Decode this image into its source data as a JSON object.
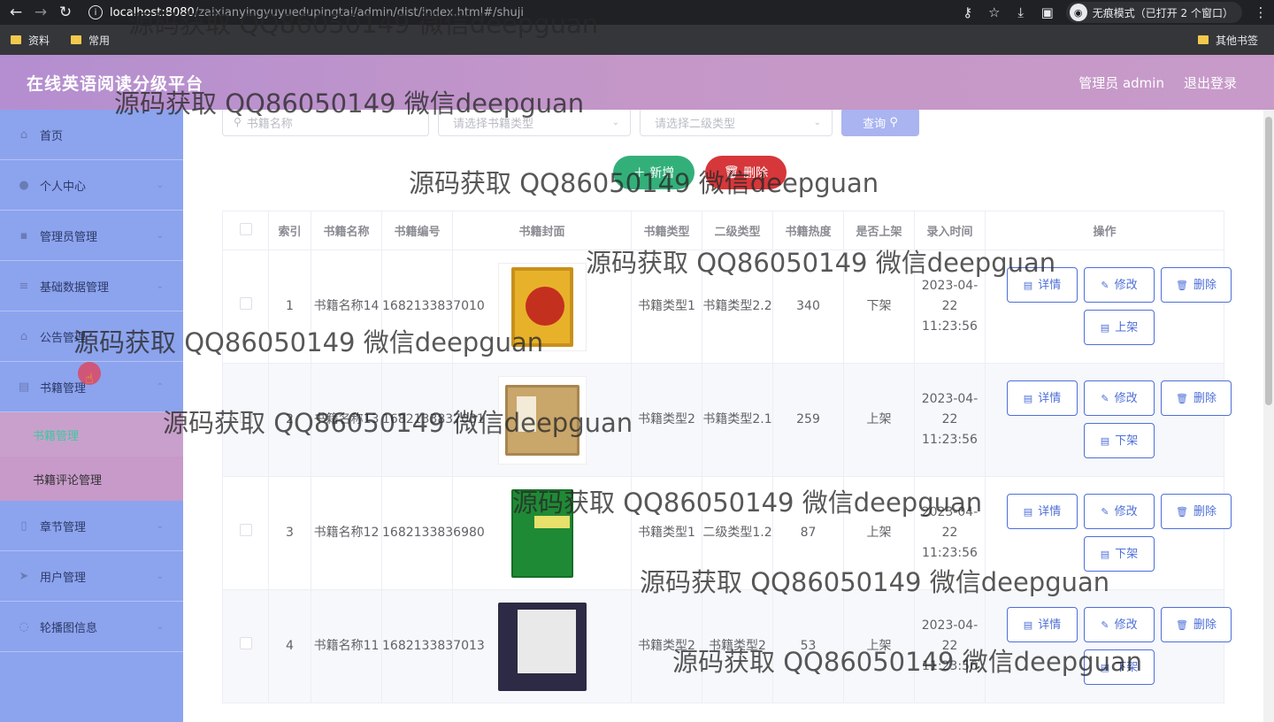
{
  "browser": {
    "url_host": "localhost:8080",
    "url_path": "/zaixianyingyuyuedupingtai/admin/dist/index.html#/shuji",
    "incognito_label": "无痕模式（已打开 2 个窗口）",
    "bookmarks": [
      "资料",
      "常用"
    ],
    "other_bookmarks": "其他书签"
  },
  "header": {
    "title": "在线英语阅读分级平台",
    "user": "管理员 admin",
    "logout": "退出登录"
  },
  "sidebar": {
    "items": [
      {
        "label": "首页",
        "icon": "home-icon"
      },
      {
        "label": "个人中心",
        "icon": "user-icon"
      },
      {
        "label": "管理员管理",
        "icon": "admin-icon"
      },
      {
        "label": "基础数据管理",
        "icon": "list-icon"
      },
      {
        "label": "公告管理",
        "icon": "notice-icon"
      },
      {
        "label": "书籍管理",
        "icon": "book-icon"
      }
    ],
    "sub_items": [
      {
        "label": "书籍管理"
      },
      {
        "label": "书籍评论管理"
      }
    ],
    "items_after": [
      {
        "label": "章节管理",
        "icon": "chapter-icon"
      },
      {
        "label": "用户管理",
        "icon": "users-icon"
      },
      {
        "label": "轮播图信息",
        "icon": "carousel-icon"
      }
    ]
  },
  "search": {
    "name_placeholder": "书籍名称",
    "type_placeholder": "请选择书籍类型",
    "subtype_placeholder": "请选择二级类型",
    "query_label": "查询"
  },
  "actions": {
    "add": "新增",
    "delete": "删除"
  },
  "table": {
    "headers": [
      "索引",
      "书籍名称",
      "书籍编号",
      "书籍封面",
      "书籍类型",
      "二级类型",
      "书籍热度",
      "是否上架",
      "录入时间",
      "操作"
    ],
    "rows": [
      {
        "index": "1",
        "name": "书籍名称14",
        "code": "1682133837010",
        "type": "书籍类型1",
        "subtype": "书籍类型2.2",
        "hot": "340",
        "status": "下架",
        "time": "2023-04-22 11:23:56",
        "toggle": "上架"
      },
      {
        "index": "2",
        "name": "书籍名称13",
        "code": "1682133837031",
        "type": "书籍类型2",
        "subtype": "书籍类型2.1",
        "hot": "259",
        "status": "上架",
        "time": "2023-04-22 11:23:56",
        "toggle": "下架"
      },
      {
        "index": "3",
        "name": "书籍名称12",
        "code": "1682133836980",
        "type": "书籍类型1",
        "subtype": "二级类型1.2",
        "hot": "87",
        "status": "上架",
        "time": "2023-04-22 11:23:56",
        "toggle": "下架"
      },
      {
        "index": "4",
        "name": "书籍名称11",
        "code": "1682133837013",
        "type": "书籍类型2",
        "subtype": "书籍类型2",
        "hot": "53",
        "status": "上架",
        "time": "2023-04-22 11:23:56",
        "toggle": "下架"
      }
    ],
    "op_detail": "详情",
    "op_edit": "修改",
    "op_delete": "删除"
  },
  "watermark": "源码获取 QQ86050149 微信deepguan"
}
